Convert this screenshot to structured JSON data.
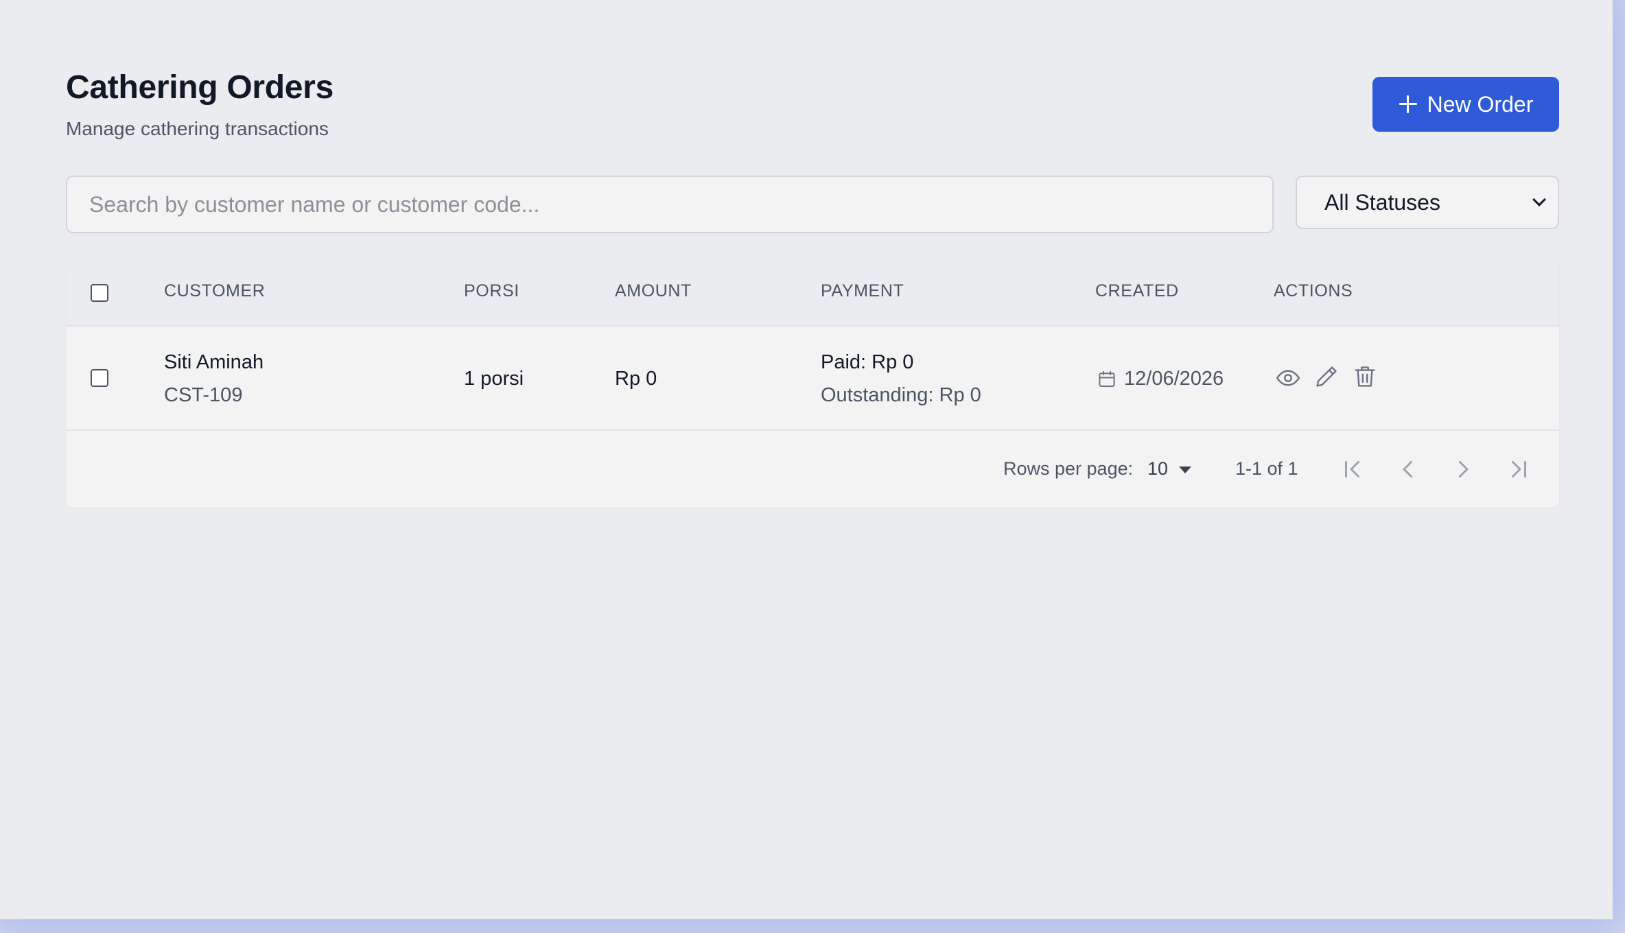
{
  "header": {
    "title": "Cathering Orders",
    "subtitle": "Manage cathering transactions",
    "new_order_label": "New Order"
  },
  "filters": {
    "search_placeholder": "Search by customer name or customer code...",
    "status_selected": "All Statuses"
  },
  "table": {
    "columns": [
      "CUSTOMER",
      "PORSI",
      "AMOUNT",
      "PAYMENT",
      "CREATED",
      "ACTIONS"
    ],
    "rows": [
      {
        "customer_name": "Siti Aminah",
        "customer_code": "CST-109",
        "porsi": "1 porsi",
        "amount": "Rp 0",
        "paid": "Paid: Rp 0",
        "outstanding": "Outstanding: Rp 0",
        "created": "12/06/2026"
      }
    ]
  },
  "pagination": {
    "rows_per_page_label": "Rows per page:",
    "rows_per_page_value": "10",
    "range": "1-1 of 1"
  },
  "icons": {
    "add": "plus-icon",
    "select": "chevron-down-icon",
    "created": "calendar-icon",
    "view": "eye-icon",
    "edit": "pencil-icon",
    "delete": "trash-icon",
    "first": "first-page-icon",
    "prev": "chevron-left-icon",
    "next": "chevron-right-icon",
    "last": "last-page-icon"
  },
  "colors": {
    "primary": "#2f5bd8",
    "background": "#ebecef",
    "text": "#111827",
    "muted": "#4b5563"
  }
}
